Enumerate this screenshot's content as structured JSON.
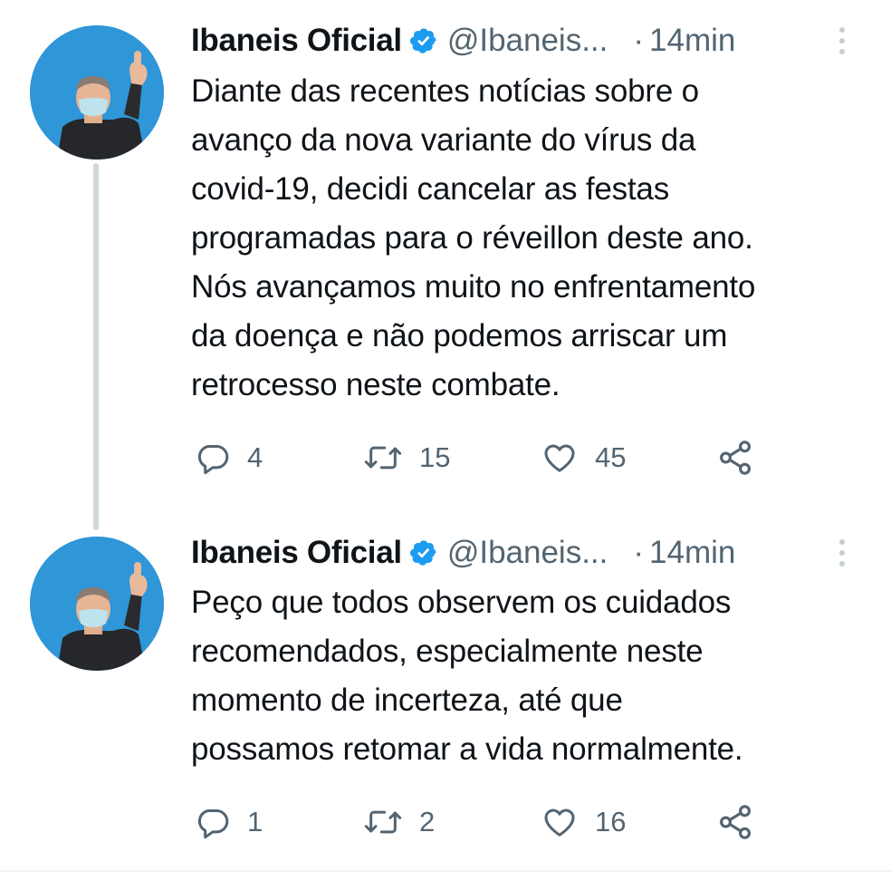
{
  "tweets": [
    {
      "name": "Ibaneis Oficial",
      "handle": "@Ibaneis...",
      "separator": "·",
      "time": "14min",
      "text": "Diante das recentes notícias sobre o\navanço da nova variante do vírus da\ncovid-19, decidi cancelar as festas\nprogramadas para o réveillon deste ano.\nNós avançamos muito no enfrentamento\nda doença e não podemos arriscar um\nretrocesso neste combate.",
      "replies": "4",
      "retweets": "15",
      "likes": "45"
    },
    {
      "name": "Ibaneis Oficial",
      "handle": "@Ibaneis...",
      "separator": "·",
      "time": "14min",
      "text": "Peço que todos observem os cuidados\nrecomendados, especialmente neste\nmomento de incerteza, até que\npossamos retomar a vida normalmente.",
      "replies": "1",
      "retweets": "2",
      "likes": "16"
    }
  ],
  "icons": {
    "verified": "verified-badge-icon",
    "more": "more-vertical-icon",
    "reply": "reply-icon",
    "retweet": "retweet-icon",
    "like": "heart-icon",
    "share": "share-icon"
  },
  "colors": {
    "verified": "#1d9bf0",
    "muted": "#536471",
    "text": "#0f1419",
    "thread_line": "#cfd9de",
    "avatar_bg": "#2f96d8"
  }
}
